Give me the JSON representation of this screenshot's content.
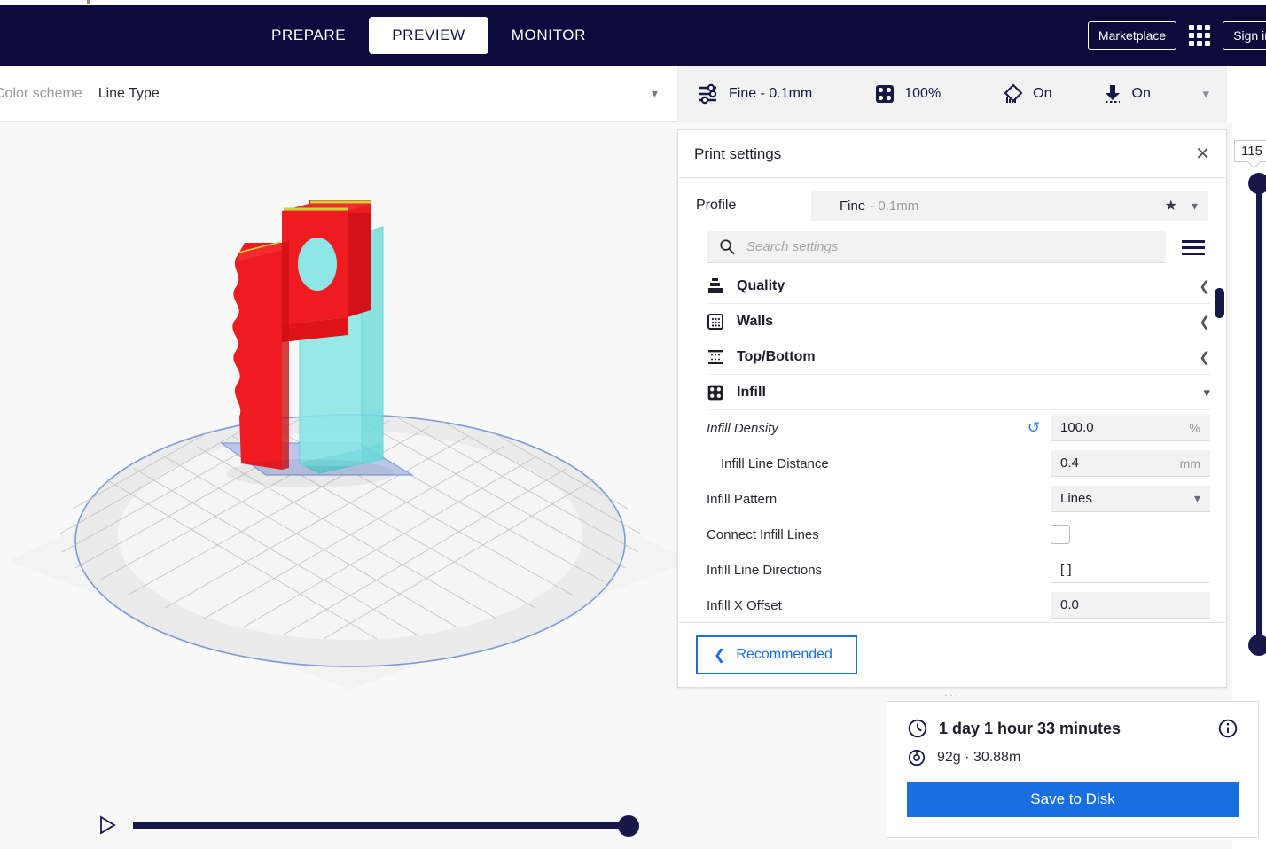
{
  "header": {
    "tabs": [
      {
        "label": "PREPARE",
        "active": false
      },
      {
        "label": "PREVIEW",
        "active": true
      },
      {
        "label": "MONITOR",
        "active": false
      }
    ],
    "marketplace_label": "Marketplace",
    "signin_label": "Sign in"
  },
  "scheme_bar": {
    "label": "Color scheme",
    "value": "Line Type"
  },
  "summary_bar": {
    "profile": "Fine - 0.1mm",
    "infill": "100%",
    "support": "On",
    "adhesion": "On"
  },
  "print_settings": {
    "title": "Print settings",
    "close_label": "✕",
    "profile_label": "Profile",
    "profile_name": "Fine",
    "profile_sub": "- 0.1mm",
    "search_placeholder": "Search settings",
    "search_value": "",
    "categories": [
      {
        "name": "Quality",
        "expanded": false
      },
      {
        "name": "Walls",
        "expanded": false
      },
      {
        "name": "Top/Bottom",
        "expanded": false
      },
      {
        "name": "Infill",
        "expanded": true
      }
    ],
    "infill_settings": [
      {
        "label": "Infill Density",
        "value": "100.0",
        "unit": "%",
        "type": "number",
        "modified": true,
        "indent": false,
        "italic": true
      },
      {
        "label": "Infill Line Distance",
        "value": "0.4",
        "unit": "mm",
        "type": "number",
        "modified": false,
        "indent": true,
        "italic": false
      },
      {
        "label": "Infill Pattern",
        "value": "Lines",
        "unit": "",
        "type": "select",
        "modified": false,
        "indent": false,
        "italic": false
      },
      {
        "label": "Connect Infill Lines",
        "value": "",
        "unit": "",
        "type": "checkbox",
        "checked": false,
        "modified": false,
        "indent": false,
        "italic": false
      },
      {
        "label": "Infill Line Directions",
        "value": "[ ]",
        "unit": "",
        "type": "text",
        "modified": false,
        "indent": false,
        "italic": false
      },
      {
        "label": "Infill X Offset",
        "value": "0.0",
        "unit": "",
        "type": "number",
        "modified": false,
        "indent": false,
        "italic": false
      }
    ],
    "recommended_label": "Recommended"
  },
  "layer_slider": {
    "value": "115"
  },
  "job_info": {
    "time": "1 day 1 hour 33 minutes",
    "material": "92g · 30.88m",
    "save_label": "Save to Disk"
  },
  "colors": {
    "header_bg": "#0d0b3d",
    "accent_blue": "#1a6fe0",
    "navy": "#17174a",
    "viewport_bg": "#f8f8f8",
    "model_red": "#ee1c20",
    "model_cyan": "#63e3e3",
    "skirt_blue": "#9aa8dd"
  }
}
